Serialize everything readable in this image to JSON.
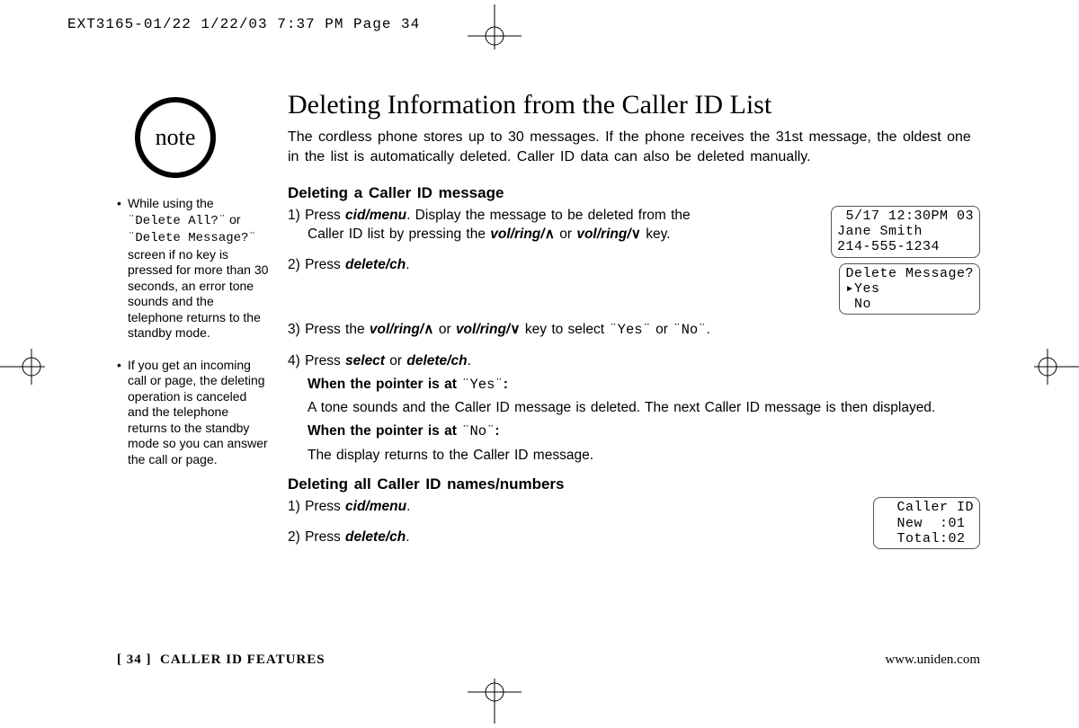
{
  "slug": "EXT3165-01/22  1/22/03  7:37 PM  Page 34",
  "note_label": "note",
  "sidebar": {
    "items": [
      {
        "pre": "While using the ",
        "lcd1": "¨Delete All?¨",
        "mid": " or ",
        "lcd2": "¨Delete Message?¨",
        "post": " screen if no key is pressed for more than 30 seconds, an error tone sounds and the telephone returns to the standby mode."
      },
      {
        "text": "If you get an incoming call or page, the deleting operation is canceled and the telephone returns to the standby mode so you can answer the call or page."
      }
    ]
  },
  "title": "Deleting Information from the Caller ID List",
  "intro": "The cordless phone stores up to 30 messages. If the phone receives the 31st message, the oldest one in the list is automatically deleted. Caller ID data can also be deleted manually.",
  "sectionA": {
    "heading": "Deleting a Caller ID message",
    "step1_a": "1) Press ",
    "step1_b": "cid/menu",
    "step1_c": ". Display the message to be deleted from the Caller ID list by pressing the ",
    "step1_d": "vol/ring/",
    "step1_e": " or ",
    "step1_f": "vol/ring/",
    "step1_g": " key.",
    "step2_a": "2) Press ",
    "step2_b": "delete/ch",
    "step2_c": ".",
    "step3_a": "3) Press the ",
    "step3_b": "vol/ring/",
    "step3_c": " or ",
    "step3_d": "vol/ring/",
    "step3_e": " key to select ",
    "step3_yes": "¨Yes¨",
    "step3_or": " or ",
    "step3_no": "¨No¨",
    "step3_f": ".",
    "step4_a": "4) Press ",
    "step4_b": "select",
    "step4_c": " or ",
    "step4_d": "delete/ch",
    "step4_e": ".",
    "yes_head_a": "When the pointer is at ",
    "yes_head_b": "¨Yes¨",
    "yes_head_c": ":",
    "yes_body": "A tone sounds and the Caller ID message is deleted. The next Caller ID message is then displayed.",
    "no_head_a": "When the pointer is at ",
    "no_head_b": "¨No¨",
    "no_head_c": ":",
    "no_body": "The display returns to the Caller ID message."
  },
  "sectionB": {
    "heading": "Deleting all Caller ID names/numbers",
    "step1_a": "1) Press ",
    "step1_b": "cid/menu",
    "step1_c": ".",
    "step2_a": "2) Press ",
    "step2_b": "delete/ch",
    "step2_c": "."
  },
  "lcd1": " 5/17 12:30PM 03\nJane Smith\n214-555-1234",
  "lcd2": "Delete Message?\n▸Yes\n No",
  "lcd3": "  Caller ID\n  New  :01\n  Total:02",
  "footer": {
    "page": "[ 34 ]",
    "section": "CALLER ID FEATURES",
    "url": "www.uniden.com"
  },
  "glyph": {
    "up": "∧",
    "down": "∨"
  }
}
